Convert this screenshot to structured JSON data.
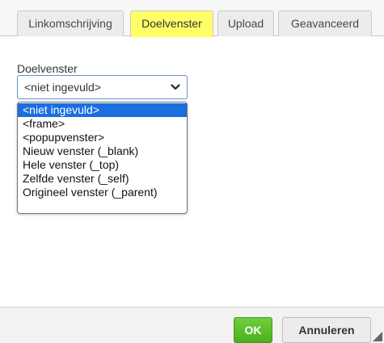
{
  "tabs": [
    {
      "label": "Linkomschrijving",
      "active": false
    },
    {
      "label": "Doelvenster",
      "active": true
    },
    {
      "label": "Upload",
      "active": false
    },
    {
      "label": "Geavanceerd",
      "active": false
    }
  ],
  "target": {
    "label": "Doelvenster",
    "selected_value": "<niet ingevuld>",
    "options": [
      "<niet ingevuld>",
      "<frame>",
      "<popupvenster>",
      "Nieuw venster (_blank)",
      "Hele venster (_top)",
      "Zelfde venster (_self)",
      "Origineel venster (_parent)"
    ],
    "highlighted_index": 0
  },
  "footer": {
    "ok_label": "OK",
    "cancel_label": "Annuleren"
  },
  "colors": {
    "active_tab": "#ffff66",
    "ok_button": "#5cb82a",
    "option_highlight": "#1a6ee0"
  },
  "icons": {
    "select_arrow": "chevron-down-icon",
    "resize": "resize-grip-icon"
  }
}
